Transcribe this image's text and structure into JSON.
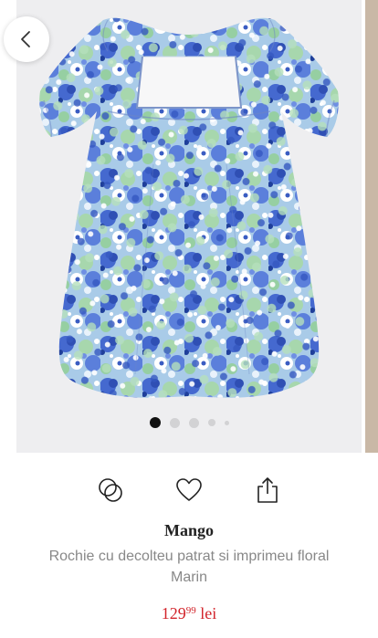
{
  "product": {
    "brand": "Mango",
    "name": "Rochie cu decolteu patrat si imprimeu floral Marin",
    "price_integer": "129",
    "price_decimals": "99",
    "currency": "lei",
    "price_color": "#d2232a"
  },
  "gallery": {
    "image_count": 5,
    "active_index": 0,
    "image_label": "floral-dress-photo"
  },
  "actions": [
    {
      "name": "compare",
      "icon": "overlapping-circles-icon"
    },
    {
      "name": "favorite",
      "icon": "heart-icon"
    },
    {
      "name": "share",
      "icon": "share-icon"
    }
  ],
  "navigation": {
    "back_icon": "chevron-left-icon"
  },
  "colors": {
    "dress_base": "#9fc3e6",
    "dress_blue": "#3f63c9",
    "dress_green": "#9fd0a8",
    "background": "#eeeef0"
  }
}
